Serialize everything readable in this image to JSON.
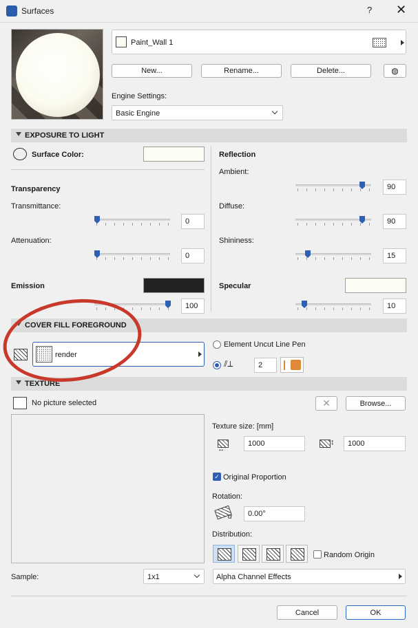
{
  "window": {
    "title": "Surfaces",
    "help": "?",
    "close": "✕"
  },
  "surface": {
    "name": "Paint_Wall 1"
  },
  "buttons": {
    "new": "New...",
    "rename": "Rename...",
    "delete": "Delete...",
    "browse": "Browse...",
    "cancel": "Cancel",
    "ok": "OK"
  },
  "engine": {
    "label": "Engine Settings:",
    "value": "Basic Engine"
  },
  "exposure": {
    "header": "EXPOSURE TO LIGHT",
    "surface_color_label": "Surface Color:",
    "surface_color": "#fcfcf2",
    "transparency_title": "Transparency",
    "transmittance_label": "Transmittance:",
    "transmittance": "0",
    "attenuation_label": "Attenuation:",
    "attenuation": "0",
    "emission_label": "Emission",
    "emission_color": "#222222",
    "emission_value": "100",
    "reflection_title": "Reflection",
    "ambient_label": "Ambient:",
    "ambient": "90",
    "diffuse_label": "Diffuse:",
    "diffuse": "90",
    "shininess_label": "Shininess:",
    "shininess": "15",
    "specular_label": "Specular",
    "specular_color": "#fcfcf2",
    "specular_value": "10"
  },
  "cover_fill": {
    "header": "COVER FILL FOREGROUND",
    "fill_name": "render",
    "uncut_pen_label": "Element Uncut Line Pen",
    "pen_number": "2",
    "pen_color": "#e0883a"
  },
  "texture": {
    "header": "TEXTURE",
    "picture_status": "No picture selected",
    "size_label": "Texture size: [mm]",
    "width": "1000",
    "height": "1000",
    "original_proportion_label": "Original Proportion",
    "original_proportion_checked": true,
    "rotation_label": "Rotation:",
    "rotation": "0.00°",
    "distribution_label": "Distribution:",
    "random_origin_label": "Random Origin",
    "sample_label": "Sample:",
    "sample_value": "1x1",
    "alpha_label": "Alpha Channel Effects"
  },
  "colors": {
    "accent": "#2f5fb3",
    "annotation": "#c8392b"
  }
}
